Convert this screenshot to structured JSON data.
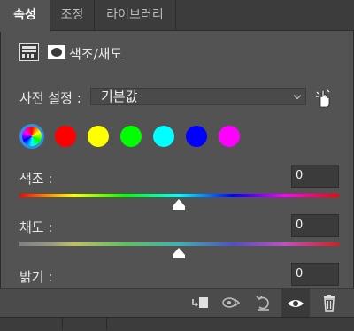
{
  "tabs": [
    {
      "label": "속성",
      "active": true
    },
    {
      "label": "조정",
      "active": false
    },
    {
      "label": "라이브러리",
      "active": false
    }
  ],
  "header": {
    "title": "색조/채도",
    "icons": [
      "hue-saturation-adjustment-icon",
      "layer-mask-icon"
    ]
  },
  "preset": {
    "label": "사전 설정 :",
    "value": "기본값",
    "icon": "targeted-adjustment-hand-icon"
  },
  "swatches": [
    {
      "name": "master",
      "color": "conic-rainbow"
    },
    {
      "name": "red",
      "color": "#ff0000"
    },
    {
      "name": "yellow",
      "color": "#ffff00"
    },
    {
      "name": "green",
      "color": "#00ff00"
    },
    {
      "name": "cyan",
      "color": "#00ffff"
    },
    {
      "name": "blue",
      "color": "#0000ff"
    },
    {
      "name": "magenta",
      "color": "#ff00ff"
    }
  ],
  "sliders": {
    "hue": {
      "label": "색조 :",
      "value": "0"
    },
    "saturation": {
      "label": "채도 :",
      "value": "0"
    },
    "lightness": {
      "label": "밝기 :",
      "value": "0"
    }
  },
  "colors": {
    "panel": "#535353",
    "selected_accent": "#2d8fe8"
  },
  "bottom_toolbar": [
    "clip-to-layer-icon",
    "view-previous-state-icon",
    "reset-icon",
    "visibility-eye-icon",
    "delete-trash-icon"
  ]
}
